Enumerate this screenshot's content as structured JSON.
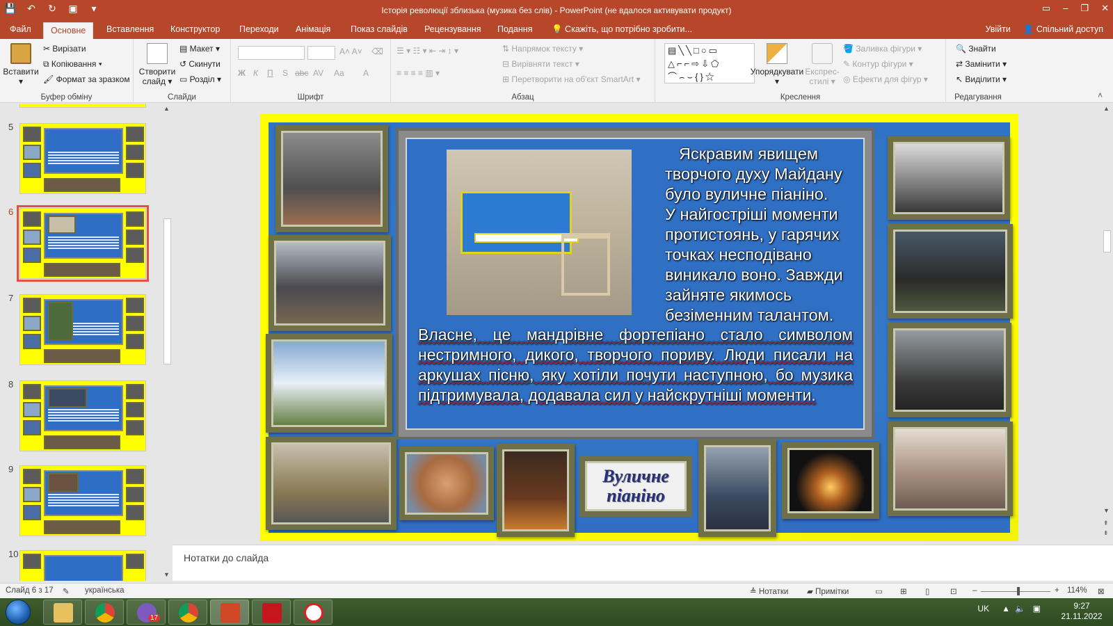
{
  "window": {
    "title": "Історія революції зблизька (музика без слів) - PowerPoint (не вдалося активувати продукт)"
  },
  "ribbon_tabs": [
    "Файл",
    "Основне",
    "Вставлення",
    "Конструктор",
    "Переходи",
    "Анімація",
    "Показ слайдів",
    "Рецензування",
    "Подання"
  ],
  "active_tab": "Основне",
  "tell_me": "Скажіть, що потрібно зробити...",
  "signin": "Увійти",
  "share": "Спільний доступ",
  "ribbon": {
    "clipboard": {
      "paste": "Вставити",
      "cut": "Вирізати",
      "copy": "Копіювання",
      "format_painter": "Формат за зразком",
      "label": "Буфер обміну"
    },
    "slides": {
      "new_slide": "Створити слайд",
      "layout": "Макет",
      "reset": "Скинути",
      "section": "Розділ",
      "label": "Слайди"
    },
    "font": {
      "label": "Шрифт",
      "bold": "Ж",
      "italic": "К",
      "underline": "П",
      "shadow": "S",
      "strike": "abc",
      "spacing": "AV",
      "case": "Aa",
      "color": "A"
    },
    "paragraph": {
      "text_direction": "Напрямок тексту",
      "align_text": "Вирівняти текст",
      "smartart": "Перетворити на об'єкт SmartArt",
      "label": "Абзац"
    },
    "drawing": {
      "arrange": "Упорядкувати",
      "quick_styles": "Експрес-стилі",
      "fill": "Заливка фігури",
      "outline": "Контур фігури",
      "effects": "Ефекти для фігур",
      "label": "Креслення"
    },
    "editing": {
      "find": "Знайти",
      "replace": "Замінити",
      "select": "Виділити",
      "label": "Редагування"
    }
  },
  "thumbnails": [
    {
      "num": "5",
      "selected": false
    },
    {
      "num": "6",
      "selected": true
    },
    {
      "num": "7",
      "selected": false
    },
    {
      "num": "8",
      "selected": false
    },
    {
      "num": "9",
      "selected": false
    },
    {
      "num": "10",
      "selected": false
    }
  ],
  "slide": {
    "text_top_lines": [
      "Яскравим явищем",
      "творчого духу Майдану",
      "було вуличне піаніно.",
      "У найгостріші моменти",
      "протистоянь, у гарячих",
      "точках несподівано",
      "виникало воно. Завжди",
      "зайняте якимось",
      "безіменним талантом."
    ],
    "text_bottom": "Власне, це мандрівне фортепіано стало символом нестримного, дикого, творчого пориву. Люди писали на аркушах пісню, яку хотіли почути наступною, бо музика підтримувала, додавала сил у найскрутніші моменти.",
    "caption_line1": "Вуличне",
    "caption_line2": "піаніно"
  },
  "notes_placeholder": "Нотатки до слайда",
  "status": {
    "slide_counter": "Слайд 6 з 17",
    "language": "українська",
    "notes": "Нотатки",
    "comments": "Примітки",
    "zoom": "114%"
  },
  "taskbar": {
    "viber_badge": "17",
    "lang": "UK",
    "time": "9:27",
    "date": "21.11.2022"
  },
  "colors": {
    "accent": "#b7472a",
    "slide_yellow": "#ffff00",
    "slide_blue": "#2f73c6"
  }
}
